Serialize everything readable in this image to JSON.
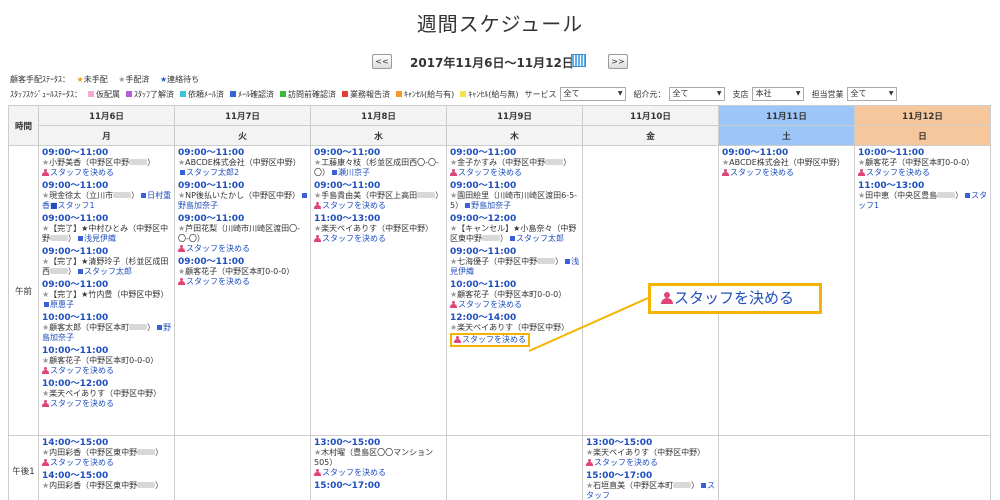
{
  "title": "週間スケジュール",
  "nav": {
    "prev": "<<",
    "next": ">>",
    "range": "2017年11月6日〜11月12日"
  },
  "legend1": {
    "label": "顧客手配ｽﾃｰﾀｽ：",
    "items": [
      "未手配",
      "手配済",
      "連絡待ち"
    ]
  },
  "legend2": {
    "label": "ｽﾀｯﾌｽｹｼﾞｭｰﾙｽﾃｰﾀｽ：",
    "items": [
      {
        "text": "仮配属",
        "color": "#f2a9d6"
      },
      {
        "text": "ｽﾀｯﾌ了解済",
        "color": "#b160d6"
      },
      {
        "text": "依頼ﾒｰﾙ済",
        "color": "#39c6d6"
      },
      {
        "text": "ﾒｰﾙ確認済",
        "color": "#3a5fd6"
      },
      {
        "text": "訪問前確認済",
        "color": "#3ab83a"
      },
      {
        "text": "業務報告済",
        "color": "#e03a3a"
      },
      {
        "text": "ｷｬﾝｾﾙ(給与有)",
        "color": "#f59a2a"
      },
      {
        "text": "ｷｬﾝｾﾙ(給与無)",
        "color": "#f5e24a"
      }
    ]
  },
  "filters": {
    "service_label": "サービス",
    "service_value": "全て",
    "referral_label": "紹介元：",
    "referral_value": "全て",
    "branch_label": "支店",
    "branch_value": "本社",
    "sales_label": "担当営業",
    "sales_value": "全て"
  },
  "grid": {
    "time_header": "時間",
    "days": [
      {
        "date": "11月6日",
        "dow": "月"
      },
      {
        "date": "11月7日",
        "dow": "火"
      },
      {
        "date": "11月8日",
        "dow": "水"
      },
      {
        "date": "11月9日",
        "dow": "木"
      },
      {
        "date": "11月10日",
        "dow": "金"
      },
      {
        "date": "11月11日",
        "dow": "土"
      },
      {
        "date": "11月12日",
        "dow": "日"
      }
    ],
    "row_labels": [
      "午前",
      "午後1"
    ],
    "assign": "スタッフを決める"
  },
  "events": {
    "am": [
      [
        {
          "time": "09:00〜11:00",
          "cust": "小野美香（中野区中野",
          "assign": true
        },
        {
          "time": "09:00〜11:00",
          "cust": "現金徐太（立川市",
          "staff": "日村重香■スタッフ1"
        },
        {
          "time": "09:00〜11:00",
          "cust": "【完了】★中村ひとみ（中野区中野",
          "staff": "浅見伊織"
        },
        {
          "time": "09:00〜11:00",
          "cust": "【完了】★清野玲子（杉並区成田西",
          "staff": "スタッフ太郎"
        },
        {
          "time": "09:00〜11:00",
          "cust": "【完了】★竹内豊（中野区中野）",
          "staff": "原惠子"
        },
        {
          "time": "10:00〜11:00",
          "cust": "顧客太郎（中野区本町",
          "staff": "野島加奈子"
        },
        {
          "time": "10:00〜11:00",
          "cust": "顧客花子（中野区本町0-0-0）",
          "assign": true
        },
        {
          "time": "10:00〜12:00",
          "cust": "楽天ペイありす（中野区中野）",
          "assign": true
        }
      ],
      [
        {
          "time": "09:00〜11:00",
          "cust": "ABCDE株式会社（中野区中野）",
          "staff": "スタッフ太郎2"
        },
        {
          "time": "09:00〜11:00",
          "cust": "NP後払いたかし（中野区中野）",
          "staff": "野島加奈子"
        },
        {
          "time": "09:00〜11:00",
          "cust": "芦田花梨（川崎市川崎区渡田〇-〇-〇）",
          "assign": true
        },
        {
          "time": "09:00〜11:00",
          "cust": "顧客花子（中野区本町0-0-0）",
          "assign": true
        }
      ],
      [
        {
          "time": "09:00〜11:00",
          "cust": "工藤康々枝（杉並区成田西〇-〇-〇）",
          "staff": "瀬川京子"
        },
        {
          "time": "09:00〜11:00",
          "cust": "手島貴由美（中野区上高田",
          "assign": true
        },
        {
          "time": "11:00〜13:00",
          "cust": "楽天ペイありす（中野区中野）",
          "assign": true
        }
      ],
      [
        {
          "time": "09:00〜11:00",
          "cust": "金子かすみ（中野区中野",
          "assign": true
        },
        {
          "time": "09:00〜11:00",
          "cust": "園田絵里（川崎市川崎区渡田6-5-5）",
          "staff": "野島加奈子"
        },
        {
          "time": "09:00〜12:00",
          "cust": "【キャンセル】★小島奈々（中野区東中野",
          "staff": "スタッフ太郎"
        },
        {
          "time": "09:00〜11:00",
          "cust": "七海優子（中野区中野",
          "staff": "浅見伊織"
        },
        {
          "time": "10:00〜11:00",
          "cust": "顧客花子（中野区本町0-0-0）",
          "assign": true
        },
        {
          "time": "12:00〜14:00",
          "cust": "楽天ペイありす（中野区中野）",
          "assign": true,
          "hl": true
        }
      ],
      [],
      [
        {
          "time": "09:00〜11:00",
          "cust": "ABCDE株式会社（中野区中野）",
          "assign": true
        }
      ],
      [
        {
          "time": "10:00〜11:00",
          "cust": "顧客花子（中野区本町0-0-0）",
          "assign": true
        },
        {
          "time": "11:00〜13:00",
          "cust": "田中恵（中央区豊島",
          "staff": "スタッフ1"
        }
      ]
    ],
    "pm": [
      [
        {
          "time": "14:00〜15:00",
          "cust": "内田彩香（中野区東中野",
          "assign": true
        },
        {
          "time": "14:00〜15:00",
          "cust": "内田彩香（中野区東中野",
          "assign": false
        }
      ],
      [],
      [
        {
          "time": "13:00〜15:00",
          "cust": "木村曜（豊島区〇〇マンション505）",
          "assign": true
        },
        {
          "time": "15:00〜17:00",
          "cust": "",
          "assign": false
        }
      ],
      [],
      [
        {
          "time": "13:00〜15:00",
          "cust": "楽天ペイありす（中野区中野）",
          "assign": true
        },
        {
          "time": "15:00〜17:00",
          "cust": "石垣直美（中野区本町",
          "staff": "スタッフ"
        }
      ],
      [],
      []
    ]
  },
  "callout": "スタッフを決める"
}
